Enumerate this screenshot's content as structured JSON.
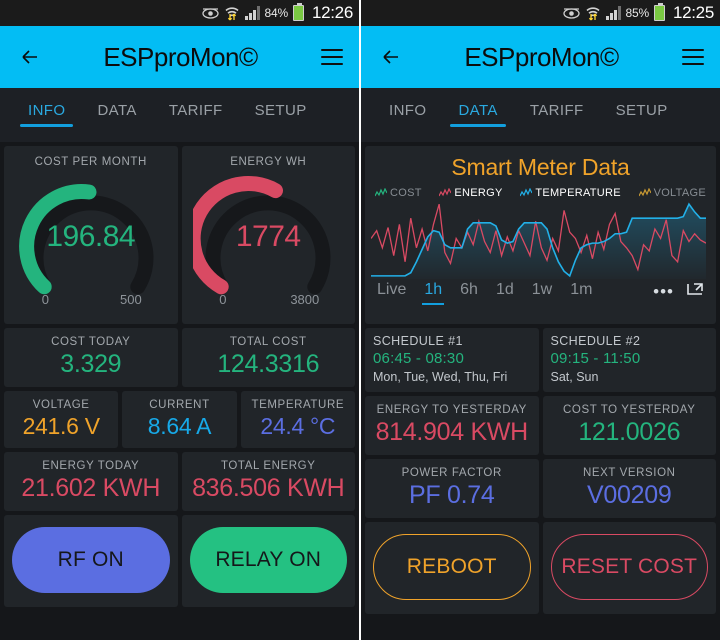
{
  "colors": {
    "accent": "#03bdf4",
    "green": "#24b47e",
    "red": "#d94a63",
    "orange": "#f0a32a",
    "cyan": "#22b0e8",
    "blue": "#5b6ee1",
    "track": "#16181b"
  },
  "panels": [
    {
      "id": "left",
      "statusbar": {
        "battery_percent": "84%",
        "time": "12:26",
        "icons": [
          "eye-icon",
          "wifi-transfer-icon",
          "signal-bars-icon",
          "battery-icon"
        ]
      },
      "appbar": {
        "title": "ESPproMon©",
        "back_label": "back-arrow",
        "menu_label": "menu"
      },
      "tabs": [
        {
          "label": "INFO",
          "active": true
        },
        {
          "label": "DATA",
          "active": false
        },
        {
          "label": "TARIFF",
          "active": false
        },
        {
          "label": "SETUP",
          "active": false
        }
      ],
      "gauges": [
        {
          "label": "COST PER MONTH",
          "value": "196.84",
          "min": "0",
          "max": "500",
          "color": "#24b47e",
          "pct": 0.3937
        },
        {
          "label": "ENERGY WH",
          "value": "1774",
          "min": "0",
          "max": "3800",
          "color": "#d94a63",
          "pct": 0.4668
        }
      ],
      "stats": [
        [
          {
            "label": "COST TODAY",
            "value": "3.329",
            "color": "#24b47e"
          },
          {
            "label": "TOTAL COST",
            "value": "124.3316",
            "color": "#24b47e"
          }
        ],
        [
          {
            "label": "VOLTAGE",
            "value": "241.6 V",
            "color": "#f0a32a"
          },
          {
            "label": "CURRENT",
            "value": "8.64 A",
            "color": "#17a9e8"
          },
          {
            "label": "TEMPERATURE",
            "value": "24.4 °C",
            "color": "#5b6ee1"
          }
        ],
        [
          {
            "label": "ENERGY TODAY",
            "value": "21.602 KWH",
            "color": "#d94a63"
          },
          {
            "label": "TOTAL ENERGY",
            "value": "836.506 KWH",
            "color": "#d94a63"
          }
        ]
      ],
      "buttons": [
        {
          "label": "RF ON",
          "style": "filled",
          "color": "#5b6ee1"
        },
        {
          "label": "RELAY ON",
          "style": "filled",
          "color": "#24c182"
        }
      ]
    },
    {
      "id": "right",
      "statusbar": {
        "battery_percent": "85%",
        "time": "12:25",
        "icons": [
          "eye-icon",
          "wifi-transfer-icon",
          "signal-bars-icon",
          "battery-icon"
        ]
      },
      "appbar": {
        "title": "ESPproMon©",
        "back_label": "back-arrow",
        "menu_label": "menu"
      },
      "tabs": [
        {
          "label": "INFO",
          "active": false
        },
        {
          "label": "DATA",
          "active": true
        },
        {
          "label": "TARIFF",
          "active": false
        },
        {
          "label": "SETUP",
          "active": false
        }
      ],
      "chart_panel": {
        "title": "Smart Meter Data",
        "legend": [
          {
            "label": "COST",
            "color": "#24b47e",
            "selected": false
          },
          {
            "label": "ENERGY",
            "color": "#d94a63",
            "selected": true
          },
          {
            "label": "TEMPERATURE",
            "color": "#22b0e8",
            "selected": true
          },
          {
            "label": "VOLTAGE",
            "color": "#c99a33",
            "selected": false
          }
        ],
        "ranges": [
          {
            "label": "Live",
            "active": false
          },
          {
            "label": "1h",
            "active": true
          },
          {
            "label": "6h",
            "active": false
          },
          {
            "label": "1d",
            "active": false
          },
          {
            "label": "1w",
            "active": false
          },
          {
            "label": "1m",
            "active": false
          }
        ],
        "tools": [
          {
            "name": "more-options-icon",
            "glyph": "•••"
          },
          {
            "name": "expand-icon",
            "glyph": "open"
          }
        ]
      },
      "schedules": [
        {
          "title": "SCHEDULE #1",
          "time": "06:45 - 08:30",
          "days": "Mon, Tue, Wed, Thu, Fri"
        },
        {
          "title": "SCHEDULE #2",
          "time": "09:15 - 11:50",
          "days": "Sat, Sun"
        }
      ],
      "stats": [
        [
          {
            "label": "ENERGY TO YESTERDAY",
            "value": "814.904 KWH",
            "color": "#d94a63"
          },
          {
            "label": "COST TO YESTERDAY",
            "value": "121.0026",
            "color": "#24b47e"
          }
        ],
        [
          {
            "label": "POWER FACTOR",
            "value": "PF 0.74",
            "color": "#5b6ee1"
          },
          {
            "label": "NEXT VERSION",
            "value": "V00209",
            "color": "#5b6ee1"
          }
        ]
      ],
      "buttons": [
        {
          "label": "REBOOT",
          "style": "outline",
          "color": "#f0a32a"
        },
        {
          "label": "RESET COST",
          "style": "outline",
          "color": "#d94a63"
        }
      ]
    }
  ],
  "chart_data": {
    "type": "line",
    "title": "Smart Meter Data",
    "xlabel": "",
    "ylabel": "",
    "grid": false,
    "legend_position": "top",
    "x_range_selected": "1h",
    "series": [
      {
        "name": "ENERGY",
        "color": "#d94a63",
        "values": [
          52,
          62,
          40,
          66,
          30,
          70,
          22,
          78,
          40,
          64,
          36,
          70,
          96,
          34,
          20,
          52,
          40,
          60,
          44,
          74,
          48,
          34,
          62,
          30,
          54,
          36,
          62,
          46,
          30,
          74,
          40,
          24,
          52,
          36,
          88,
          60,
          52,
          34,
          56,
          26,
          60,
          38,
          70,
          84,
          48,
          40,
          30,
          12,
          44,
          36,
          64,
          52,
          76,
          30,
          22,
          62,
          48,
          58,
          50,
          46
        ]
      },
      {
        "name": "TEMPERATURE",
        "color": "#22b0e8",
        "values": [
          4,
          4,
          4,
          4,
          4,
          4,
          4,
          8,
          22,
          38,
          54,
          62,
          60,
          44,
          40,
          40,
          40,
          64,
          72,
          72,
          72,
          72,
          68,
          50,
          46,
          48,
          64,
          72,
          72,
          72,
          72,
          64,
          40,
          22,
          10,
          4,
          24,
          40,
          44,
          46,
          46,
          48,
          52,
          58,
          58,
          60,
          78,
          78,
          78,
          78,
          78,
          78,
          78,
          78,
          78,
          80,
          96,
          86,
          78,
          78
        ]
      }
    ],
    "ylim": [
      0,
      100
    ]
  }
}
